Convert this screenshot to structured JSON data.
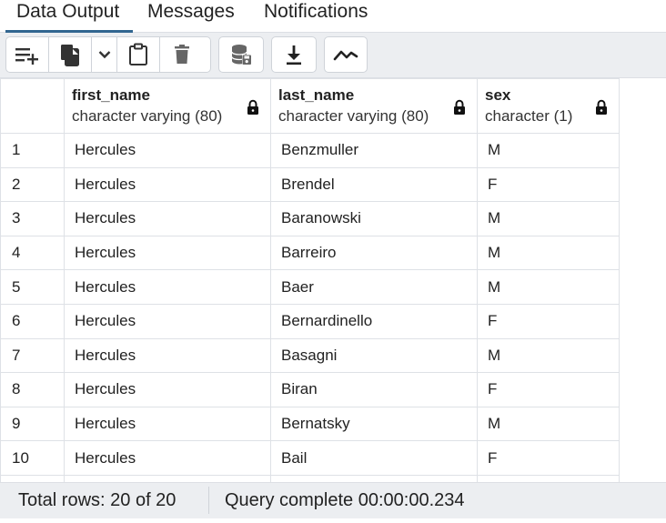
{
  "tabs": [
    {
      "label": "Data Output",
      "active": true
    },
    {
      "label": "Messages",
      "active": false
    },
    {
      "label": "Notifications",
      "active": false
    }
  ],
  "toolbar": {
    "buttons": [
      {
        "name": "add-row",
        "icon": "add-row-icon"
      },
      {
        "name": "copy",
        "icon": "copy-icon"
      },
      {
        "name": "copy-options",
        "icon": "chevron-down-icon"
      },
      {
        "name": "paste",
        "icon": "clipboard-icon"
      },
      {
        "name": "delete",
        "icon": "trash-icon"
      },
      {
        "name": "save-data",
        "icon": "database-save-icon"
      },
      {
        "name": "download",
        "icon": "download-icon"
      },
      {
        "name": "graph-visualiser",
        "icon": "line-chart-icon"
      }
    ]
  },
  "grid": {
    "columns": [
      {
        "name": "first_name",
        "type": "character varying (80)"
      },
      {
        "name": "last_name",
        "type": "character varying (80)"
      },
      {
        "name": "sex",
        "type": "character (1)"
      }
    ],
    "rows": [
      {
        "num": "1",
        "first_name": "Hercules",
        "last_name": "Benzmuller",
        "sex": "M"
      },
      {
        "num": "2",
        "first_name": "Hercules",
        "last_name": "Brendel",
        "sex": "F"
      },
      {
        "num": "3",
        "first_name": "Hercules",
        "last_name": "Baranowski",
        "sex": "M"
      },
      {
        "num": "4",
        "first_name": "Hercules",
        "last_name": "Barreiro",
        "sex": "M"
      },
      {
        "num": "5",
        "first_name": "Hercules",
        "last_name": "Baer",
        "sex": "M"
      },
      {
        "num": "6",
        "first_name": "Hercules",
        "last_name": "Bernardinello",
        "sex": "F"
      },
      {
        "num": "7",
        "first_name": "Hercules",
        "last_name": "Basagni",
        "sex": "M"
      },
      {
        "num": "8",
        "first_name": "Hercules",
        "last_name": "Biran",
        "sex": "F"
      },
      {
        "num": "9",
        "first_name": "Hercules",
        "last_name": "Bernatsky",
        "sex": "M"
      },
      {
        "num": "10",
        "first_name": "Hercules",
        "last_name": "Bail",
        "sex": "F"
      }
    ]
  },
  "status": {
    "total_rows": "Total rows: 20 of 20",
    "query": "Query complete 00:00:00.234"
  },
  "colors": {
    "active_tab_underline": "#326690",
    "toolbar_bg": "#eceef1",
    "grid_border": "#dee1e6"
  }
}
